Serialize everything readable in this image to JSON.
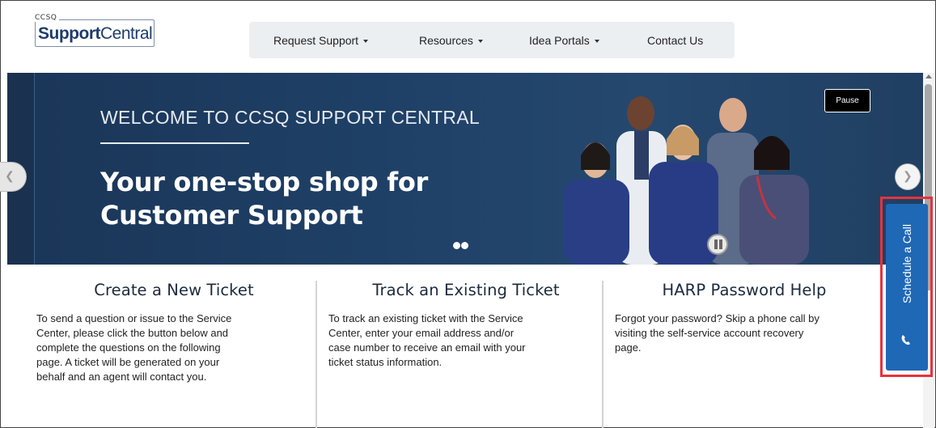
{
  "header": {
    "logo_top": "CCSQ",
    "logo_main_bold": "Support",
    "logo_main_rest": "Central"
  },
  "nav": {
    "items": [
      {
        "label": "Request Support",
        "dropdown": true
      },
      {
        "label": "Resources",
        "dropdown": true
      },
      {
        "label": "Idea Portals",
        "dropdown": true
      },
      {
        "label": "Contact Us",
        "dropdown": false
      }
    ]
  },
  "banner": {
    "welcome": "WELCOME TO CCSQ SUPPORT CENTRAL",
    "tagline_line1": "Your one-stop shop for",
    "tagline_line2": "Customer Support",
    "pause_label": "Pause",
    "bg_color": "#1f4066"
  },
  "schedule": {
    "label": "Schedule a Call",
    "bg_color": "#1f68b6",
    "highlight_color": "#e8323c"
  },
  "columns": [
    {
      "title": "Create a New Ticket",
      "lines": [
        "To send a question or issue to the Service",
        "Center, please click the button below and",
        "complete the questions on the following",
        "page. A ticket will be generated on your",
        "behalf and an agent will contact you."
      ]
    },
    {
      "title": "Track an Existing Ticket",
      "lines": [
        "To track an existing ticket with the Service",
        "Center, enter your email address and/or",
        "case number to receive an email with your",
        "ticket status information."
      ]
    },
    {
      "title": "HARP Password Help",
      "lines": [
        "Forgot your password? Skip a phone call by",
        "visiting the self-service account recovery",
        "page."
      ]
    }
  ]
}
